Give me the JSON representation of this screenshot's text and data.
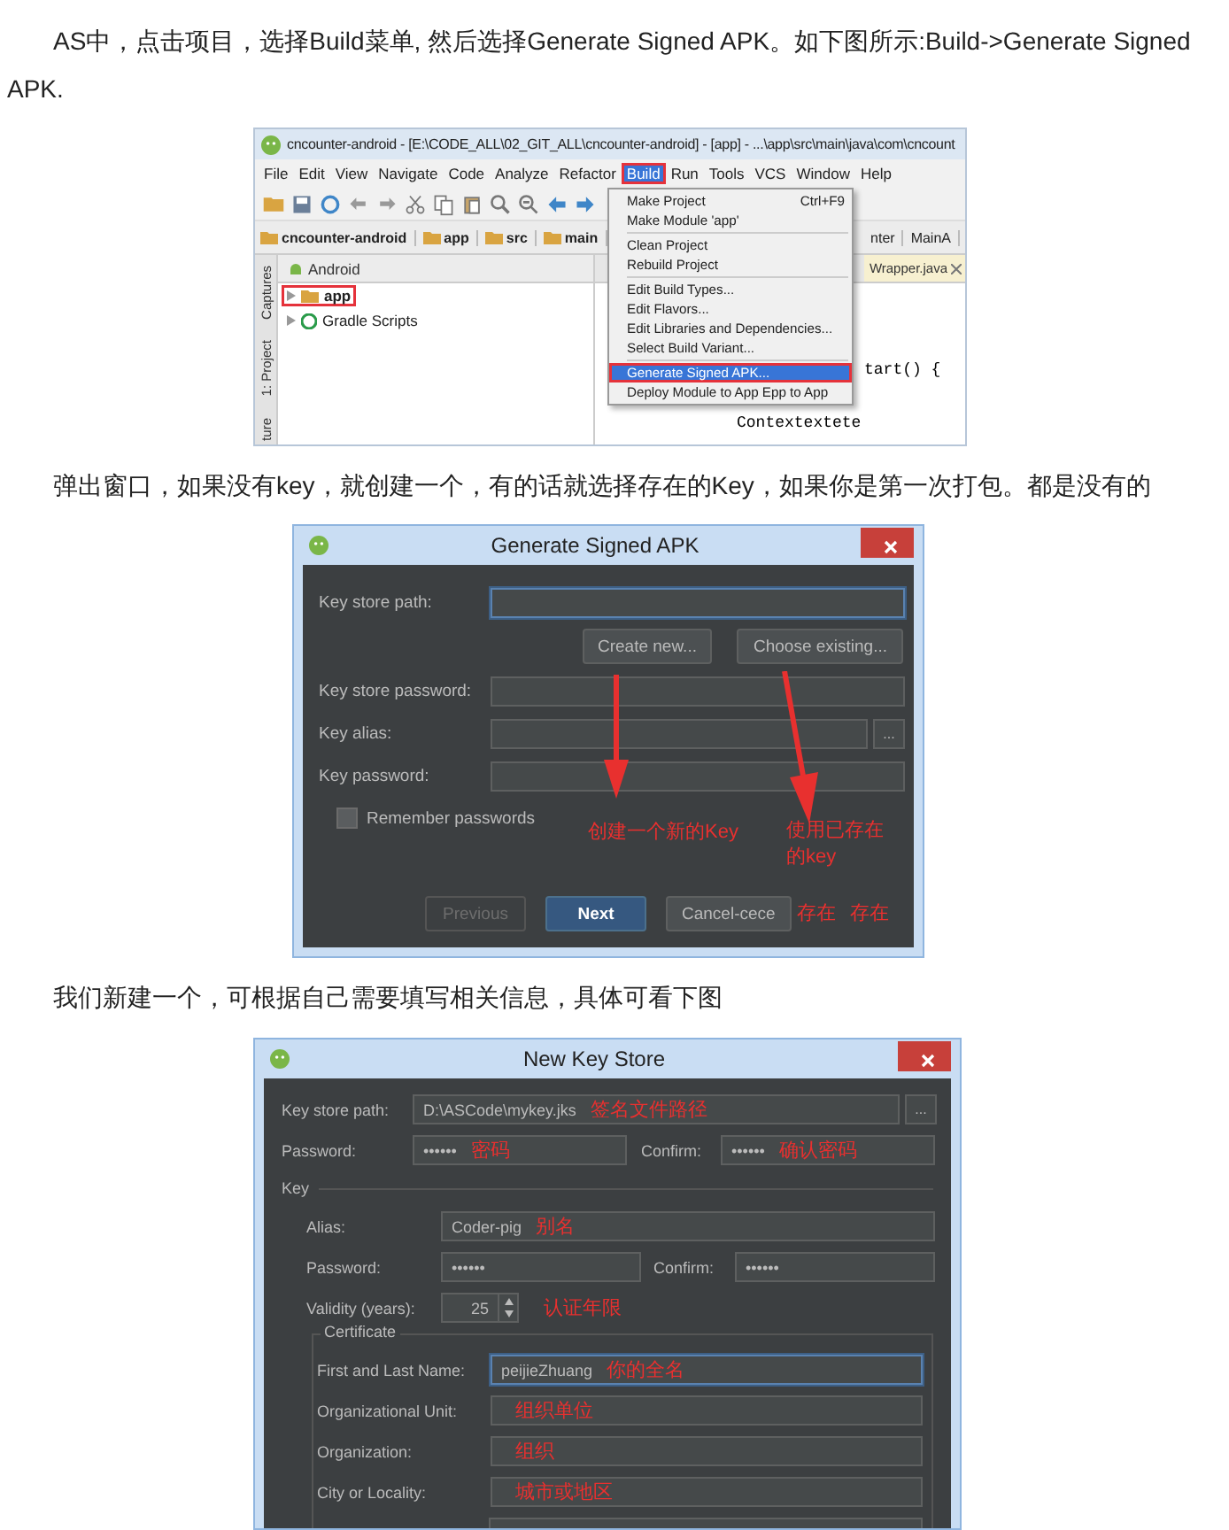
{
  "intro_paragraph": "AS中，点击项目，选择Build菜单, 然后选择Generate Signed APK。如下图所示:Build->Generate Signed APK.",
  "ide_screenshot": {
    "title": "cncounter-android - [E:\\CODE_ALL\\02_GIT_ALL\\cncounter-android] - [app] - ...\\app\\src\\main\\java\\com\\cncount",
    "menu": [
      {
        "label": "File",
        "selected": false,
        "highlighted": false
      },
      {
        "label": "Edit",
        "selected": false,
        "highlighted": false
      },
      {
        "label": "View",
        "selected": false,
        "highlighted": false
      },
      {
        "label": "Navigate",
        "selected": false,
        "highlighted": false
      },
      {
        "label": "Code",
        "selected": false,
        "highlighted": false
      },
      {
        "label": "Analyze",
        "selected": false,
        "highlighted": false
      },
      {
        "label": "Refactor",
        "selected": false,
        "highlighted": false
      },
      {
        "label": "Build",
        "selected": true,
        "highlighted": true
      },
      {
        "label": "Run",
        "selected": false,
        "highlighted": false
      },
      {
        "label": "Tools",
        "selected": false,
        "highlighted": false
      },
      {
        "label": "VCS",
        "selected": false,
        "highlighted": false
      },
      {
        "label": "Window",
        "selected": false,
        "highlighted": false
      },
      {
        "label": "Help",
        "selected": false,
        "highlighted": false
      }
    ],
    "breadcrumbs": [
      "cncounter-android",
      "app",
      "src",
      "main"
    ],
    "breadcrumbs_right": [
      "nter",
      "MainA"
    ],
    "side_tabs": [
      "Captures",
      "1: Project",
      "ture"
    ],
    "view_selector": "Android",
    "tree": [
      {
        "label": "app",
        "highlighted": true
      },
      {
        "label": "Gradle Scripts",
        "highlighted": false
      }
    ],
    "editor_tab": "Wrapper.java",
    "code_lines": [
      "tart() {",
      "Contextextete"
    ],
    "build_menu": [
      {
        "kind": "item",
        "label": "Make Project",
        "shortcut": "Ctrl+F9",
        "selected": false,
        "highlighted": false
      },
      {
        "kind": "item",
        "label": "Make Module 'app'",
        "selected": false,
        "highlighted": false
      },
      {
        "kind": "separator"
      },
      {
        "kind": "item",
        "label": "Clean Project",
        "selected": false,
        "highlighted": false
      },
      {
        "kind": "item",
        "label": "Rebuild Project",
        "selected": false,
        "highlighted": false
      },
      {
        "kind": "separator"
      },
      {
        "kind": "item",
        "label": "Edit Build Types...",
        "selected": false,
        "highlighted": false
      },
      {
        "kind": "item",
        "label": "Edit Flavors...",
        "selected": false,
        "highlighted": false
      },
      {
        "kind": "item",
        "label": "Edit Libraries and Dependencies...",
        "selected": false,
        "highlighted": false
      },
      {
        "kind": "item",
        "label": "Select Build Variant...",
        "selected": false,
        "highlighted": false
      },
      {
        "kind": "separator"
      },
      {
        "kind": "item",
        "label": "Generate Signed APK...",
        "selected": true,
        "highlighted": true
      },
      {
        "kind": "item",
        "label": "Deploy Module to App Epp to App",
        "selected": false,
        "highlighted": false
      }
    ]
  },
  "paragraph_2": "弹出窗口，如果没有key，就创建一个，有的话就选择存在的Key，如果你是第一次打包。都是没有的",
  "signed_apk_dialog": {
    "title": "Generate Signed APK",
    "fields": [
      {
        "label": "Key store path:",
        "focused": true
      },
      {
        "label": "Key store password:",
        "focused": false
      },
      {
        "label": "Key alias:",
        "focused": false,
        "browse": "..."
      },
      {
        "label": "Key password:",
        "focused": false
      }
    ],
    "keystore_buttons": [
      "Create new...",
      "Choose existing..."
    ],
    "remember": {
      "label": "Remember passwords",
      "checked": false
    },
    "footer_buttons": [
      {
        "label": "Previous",
        "disabled": true,
        "default": false
      },
      {
        "label": "Next",
        "disabled": false,
        "default": true
      },
      {
        "label": "Cancel-cece",
        "disabled": false,
        "default": false
      }
    ],
    "annotations": [
      "创建一个新的Key",
      "使用已存在的key",
      "存在",
      "存在"
    ]
  },
  "paragraph_3": "我们新建一个，可根据自己需要填写相关信息，具体可看下图",
  "key_store_dialog": {
    "title": "New Key Store",
    "path": {
      "label": "Key store path:",
      "value": "D:\\ASCode\\mykey.jks",
      "note": "签名文件路径",
      "browse": "..."
    },
    "password": {
      "label": "Password:",
      "value": "••••••",
      "note": "密码"
    },
    "confirm": {
      "label": "Confirm:",
      "value": "••••••",
      "note": "确认密码"
    },
    "key_section": "Key",
    "alias": {
      "label": "Alias:",
      "value": "Coder-pig",
      "note": "别名"
    },
    "key_password": {
      "label": "Password:",
      "value": "••••••"
    },
    "key_confirm": {
      "label": "Confirm:",
      "value": "••••••"
    },
    "validity": {
      "label": "Validity (years):",
      "value": "25",
      "note": "认证年限"
    },
    "certificate_section": "Certificate",
    "certificate_fields": [
      {
        "label": "First and Last Name:",
        "value": "peijieZhuang",
        "note": "你的全名",
        "focused": true
      },
      {
        "label": "Organizational Unit:",
        "note": "组织单位",
        "focused": false
      },
      {
        "label": "Organization:",
        "note": "组织",
        "focused": false
      },
      {
        "label": "City or Locality:",
        "note": "城市或地区",
        "focused": false
      },
      {
        "focused": false
      }
    ]
  }
}
